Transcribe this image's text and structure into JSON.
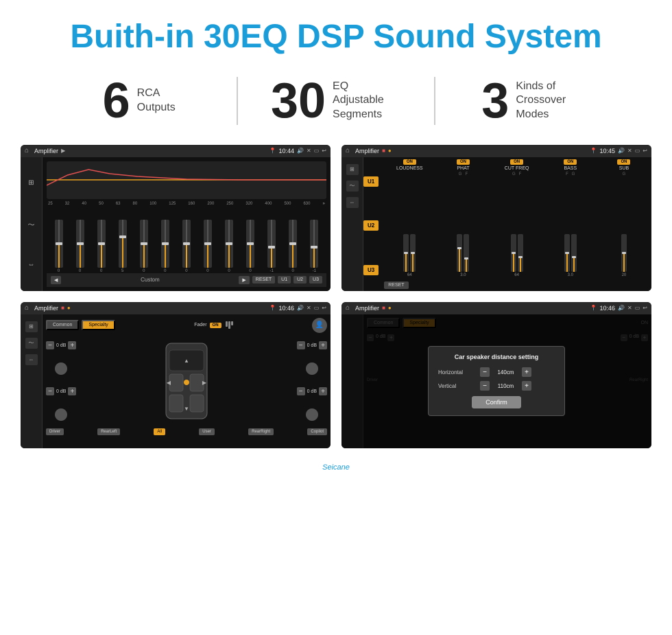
{
  "header": {
    "title": "Buith-in 30EQ DSP Sound System"
  },
  "stats": [
    {
      "number": "6",
      "label": "RCA\nOutputs"
    },
    {
      "number": "30",
      "label": "EQ Adjustable\nSegments"
    },
    {
      "number": "3",
      "label": "Kinds of\nCrossover Modes"
    }
  ],
  "screens": {
    "eq": {
      "title": "Amplifier",
      "time": "10:44",
      "freq_labels": [
        "25",
        "32",
        "40",
        "50",
        "63",
        "80",
        "100",
        "125",
        "160",
        "200",
        "250",
        "320",
        "400",
        "500",
        "630"
      ],
      "values": [
        "0",
        "0",
        "0",
        "5",
        "0",
        "0",
        "0",
        "0",
        "0",
        "0",
        "-1",
        "0",
        "-1"
      ],
      "buttons": [
        "RESET",
        "U1",
        "U2",
        "U3"
      ],
      "custom_label": "Custom"
    },
    "amp": {
      "title": "Amplifier",
      "time": "10:45",
      "channels": [
        "LOUDNESS",
        "PHAT",
        "CUT FREQ",
        "BASS",
        "SUB"
      ],
      "u_buttons": [
        "U1",
        "U2",
        "U3"
      ],
      "reset_label": "RESET"
    },
    "speaker": {
      "title": "Amplifier",
      "time": "10:46",
      "tabs": [
        "Common",
        "Specialty"
      ],
      "fader_label": "Fader",
      "fader_on": "ON",
      "zones": [
        "Driver",
        "RearLeft",
        "All",
        "User",
        "RearRight",
        "Copilot"
      ],
      "db_values": [
        "0 dB",
        "0 dB",
        "0 dB",
        "0 dB"
      ]
    },
    "dialog": {
      "title": "Amplifier",
      "time": "10:46",
      "dialog": {
        "title": "Car speaker distance setting",
        "horizontal_label": "Horizontal",
        "horizontal_value": "140cm",
        "vertical_label": "Vertical",
        "vertical_value": "110cm",
        "confirm_label": "Confirm"
      },
      "zones_right": [
        "0 dB",
        "0 dB"
      ],
      "buttons_right": [
        "Copilot",
        "RearRight"
      ]
    }
  },
  "watermark": "Seicane"
}
